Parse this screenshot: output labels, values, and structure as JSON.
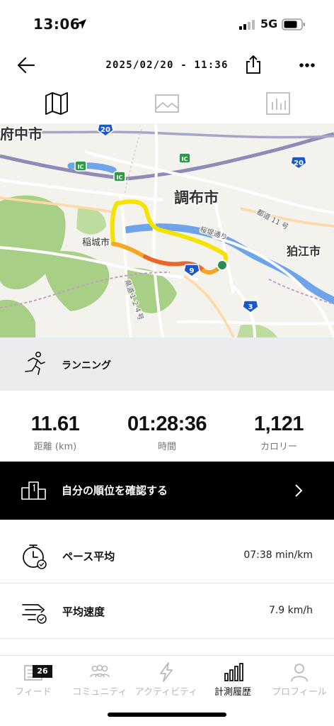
{
  "status_bar": {
    "time": "13:06",
    "network": "5G"
  },
  "header": {
    "date": "2025/02/20 - 11:36"
  },
  "view_tabs": [
    {
      "name": "map",
      "icon": "map-icon",
      "active": true
    },
    {
      "name": "photos",
      "icon": "image-icon",
      "active": false
    },
    {
      "name": "charts",
      "icon": "bar-chart-icon",
      "active": false
    }
  ],
  "map": {
    "labels": {
      "fuchu": "府中市",
      "chofu": "調布市",
      "komae": "狛江市",
      "inagi": "稲城市",
      "sakurazutsumi": "桜堤通り",
      "route11": "都道 11 号",
      "route124": "県道１２４号"
    },
    "shields": {
      "r20_a": "20",
      "r20_b": "20",
      "r9": "9",
      "r3": "3",
      "ic_a": "IC",
      "ic_b": "IC",
      "ic_c": "IC"
    },
    "colors": {
      "route_fast": "#f4e200",
      "route_mid": "#f5a623",
      "route_slow": "#e8682a",
      "route_end": "#79c043",
      "river": "#6ea5ea",
      "park": "#a7cf86"
    }
  },
  "activity": {
    "type_label": "ランニング",
    "icon": "runner-icon"
  },
  "stats": {
    "distance": {
      "value": "11.61",
      "label": "距離 (km)"
    },
    "duration": {
      "value": "01:28:36",
      "label": "時間"
    },
    "calories": {
      "value": "1,121",
      "label": "カロリー"
    }
  },
  "ranking": {
    "label": "自分の順位を確認する",
    "icon": "podium-icon"
  },
  "metrics": [
    {
      "label": "ペース平均",
      "value": "07:38 min/km",
      "icon": "stopwatch-icon"
    },
    {
      "label": "平均速度",
      "value": "7.9 km/h",
      "icon": "speed-icon"
    }
  ],
  "tab_bar": {
    "items": [
      {
        "label": "フィード",
        "icon": "feed-icon",
        "badge": "26",
        "active": false
      },
      {
        "label": "コミュニティ",
        "icon": "community-icon",
        "active": false
      },
      {
        "label": "アクティビティ",
        "icon": "lightning-icon",
        "active": false
      },
      {
        "label": "計測履歴",
        "icon": "history-icon",
        "active": true
      },
      {
        "label": "プロフィール",
        "icon": "profile-icon",
        "active": false
      }
    ]
  }
}
